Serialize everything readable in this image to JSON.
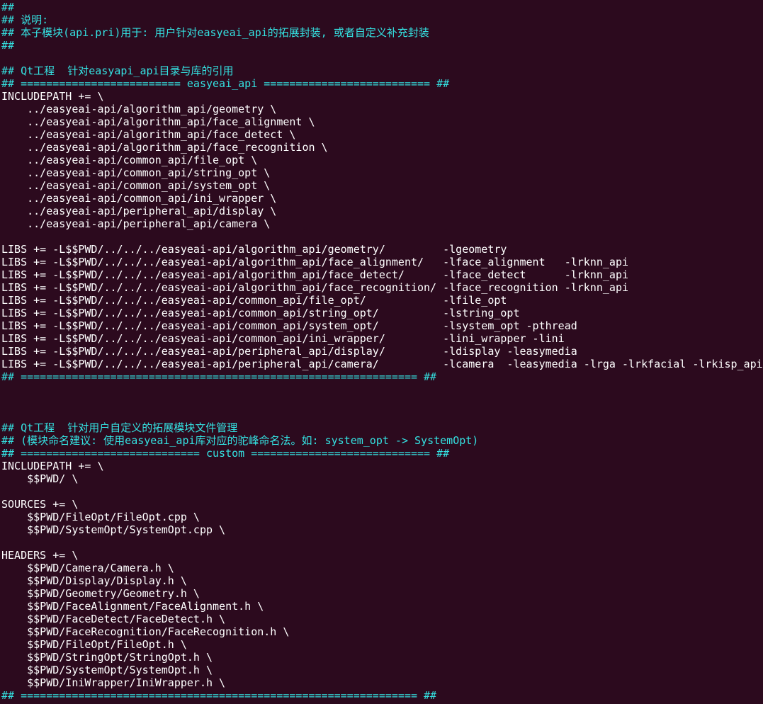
{
  "colors": {
    "background": "#2c0a1e",
    "comment": "#34e2e2",
    "code": "#ffffff"
  },
  "file": {
    "lines": [
      {
        "kind": "comment",
        "text": "##"
      },
      {
        "kind": "comment",
        "text": "## 说明:"
      },
      {
        "kind": "comment",
        "text": "## 本子模块(api.pri)用于: 用户针对easyeai_api的拓展封装, 或者自定义补充封装"
      },
      {
        "kind": "comment",
        "text": "##"
      },
      {
        "kind": "blank",
        "text": ""
      },
      {
        "kind": "comment",
        "text": "## Qt工程  针对easyapi_api目录与库的引用"
      },
      {
        "kind": "comment",
        "text": "## ========================= easyeai_api ========================== ##"
      },
      {
        "kind": "code",
        "text": "INCLUDEPATH += \\"
      },
      {
        "kind": "code",
        "text": "    ../easyeai-api/algorithm_api/geometry \\"
      },
      {
        "kind": "code",
        "text": "    ../easyeai-api/algorithm_api/face_alignment \\"
      },
      {
        "kind": "code",
        "text": "    ../easyeai-api/algorithm_api/face_detect \\"
      },
      {
        "kind": "code",
        "text": "    ../easyeai-api/algorithm_api/face_recognition \\"
      },
      {
        "kind": "code",
        "text": "    ../easyeai-api/common_api/file_opt \\"
      },
      {
        "kind": "code",
        "text": "    ../easyeai-api/common_api/string_opt \\"
      },
      {
        "kind": "code",
        "text": "    ../easyeai-api/common_api/system_opt \\"
      },
      {
        "kind": "code",
        "text": "    ../easyeai-api/common_api/ini_wrapper \\"
      },
      {
        "kind": "code",
        "text": "    ../easyeai-api/peripheral_api/display \\"
      },
      {
        "kind": "code",
        "text": "    ../easyeai-api/peripheral_api/camera \\"
      },
      {
        "kind": "blank",
        "text": ""
      },
      {
        "kind": "code",
        "text": "LIBS += -L$$PWD/../../../easyeai-api/algorithm_api/geometry/         -lgeometry"
      },
      {
        "kind": "code",
        "text": "LIBS += -L$$PWD/../../../easyeai-api/algorithm_api/face_alignment/   -lface_alignment   -lrknn_api"
      },
      {
        "kind": "code",
        "text": "LIBS += -L$$PWD/../../../easyeai-api/algorithm_api/face_detect/      -lface_detect      -lrknn_api"
      },
      {
        "kind": "code",
        "text": "LIBS += -L$$PWD/../../../easyeai-api/algorithm_api/face_recognition/ -lface_recognition -lrknn_api"
      },
      {
        "kind": "code",
        "text": "LIBS += -L$$PWD/../../../easyeai-api/common_api/file_opt/            -lfile_opt"
      },
      {
        "kind": "code",
        "text": "LIBS += -L$$PWD/../../../easyeai-api/common_api/string_opt/          -lstring_opt"
      },
      {
        "kind": "code",
        "text": "LIBS += -L$$PWD/../../../easyeai-api/common_api/system_opt/          -lsystem_opt -pthread"
      },
      {
        "kind": "code",
        "text": "LIBS += -L$$PWD/../../../easyeai-api/common_api/ini_wrapper/         -lini_wrapper -lini"
      },
      {
        "kind": "code",
        "text": "LIBS += -L$$PWD/../../../easyeai-api/peripheral_api/display/         -ldisplay -leasymedia"
      },
      {
        "kind": "code",
        "text": "LIBS += -L$$PWD/../../../easyeai-api/peripheral_api/camera/          -lcamera  -leasymedia -lrga -lrkfacial -lrkisp_api"
      },
      {
        "kind": "comment",
        "text": "## ============================================================== ##"
      },
      {
        "kind": "blank",
        "text": ""
      },
      {
        "kind": "blank",
        "text": ""
      },
      {
        "kind": "blank",
        "text": ""
      },
      {
        "kind": "comment",
        "text": "## Qt工程  针对用户自定义的拓展模块文件管理"
      },
      {
        "kind": "comment",
        "text": "## (模块命名建议: 使用easyeai_api库对应的驼峰命名法。如: system_opt -> SystemOpt)"
      },
      {
        "kind": "comment",
        "text": "## ============================ custom ============================ ##"
      },
      {
        "kind": "code",
        "text": "INCLUDEPATH += \\"
      },
      {
        "kind": "code",
        "text": "    $$PWD/ \\"
      },
      {
        "kind": "blank",
        "text": ""
      },
      {
        "kind": "code",
        "text": "SOURCES += \\"
      },
      {
        "kind": "code",
        "text": "    $$PWD/FileOpt/FileOpt.cpp \\"
      },
      {
        "kind": "code",
        "text": "    $$PWD/SystemOpt/SystemOpt.cpp \\"
      },
      {
        "kind": "blank",
        "text": ""
      },
      {
        "kind": "code",
        "text": "HEADERS += \\"
      },
      {
        "kind": "code",
        "text": "    $$PWD/Camera/Camera.h \\"
      },
      {
        "kind": "code",
        "text": "    $$PWD/Display/Display.h \\"
      },
      {
        "kind": "code",
        "text": "    $$PWD/Geometry/Geometry.h \\"
      },
      {
        "kind": "code",
        "text": "    $$PWD/FaceAlignment/FaceAlignment.h \\"
      },
      {
        "kind": "code",
        "text": "    $$PWD/FaceDetect/FaceDetect.h \\"
      },
      {
        "kind": "code",
        "text": "    $$PWD/FaceRecognition/FaceRecognition.h \\"
      },
      {
        "kind": "code",
        "text": "    $$PWD/FileOpt/FileOpt.h \\"
      },
      {
        "kind": "code",
        "text": "    $$PWD/StringOpt/StringOpt.h \\"
      },
      {
        "kind": "code",
        "text": "    $$PWD/SystemOpt/SystemOpt.h \\"
      },
      {
        "kind": "code",
        "text": "    $$PWD/IniWrapper/IniWrapper.h \\"
      },
      {
        "kind": "comment",
        "text": "## ============================================================== ##"
      }
    ]
  }
}
